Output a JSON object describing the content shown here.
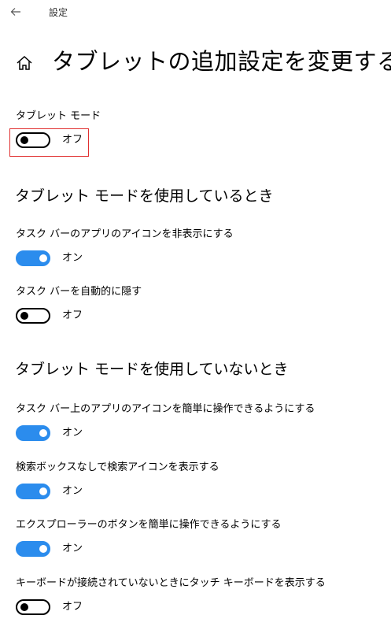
{
  "window": {
    "app_title": "設定",
    "back_icon": "back-arrow-icon"
  },
  "header": {
    "home_icon": "home-icon",
    "title": "タブレットの追加設定を変更する"
  },
  "tablet_mode": {
    "label": "タブレット モード",
    "state": "off",
    "state_label": "オフ"
  },
  "sections": [
    {
      "heading": "タブレット モードを使用しているとき",
      "settings": [
        {
          "label": "タスク バーのアプリのアイコンを非表示にする",
          "state": "on",
          "state_label": "オン"
        },
        {
          "label": "タスク バーを自動的に隠す",
          "state": "off",
          "state_label": "オフ"
        }
      ]
    },
    {
      "heading": "タブレット モードを使用していないとき",
      "settings": [
        {
          "label": "タスク バー上のアプリのアイコンを簡単に操作できるようにする",
          "state": "on",
          "state_label": "オン"
        },
        {
          "label": "検索ボックスなしで検索アイコンを表示する",
          "state": "on",
          "state_label": "オン"
        },
        {
          "label": "エクスプローラーのボタンを簡単に操作できるようにする",
          "state": "on",
          "state_label": "オン"
        },
        {
          "label": "キーボードが接続されていないときにタッチ キーボードを表示する",
          "state": "off",
          "state_label": "オフ"
        }
      ]
    }
  ],
  "colors": {
    "accent": "#2b8ced",
    "highlight": "#e03030"
  }
}
